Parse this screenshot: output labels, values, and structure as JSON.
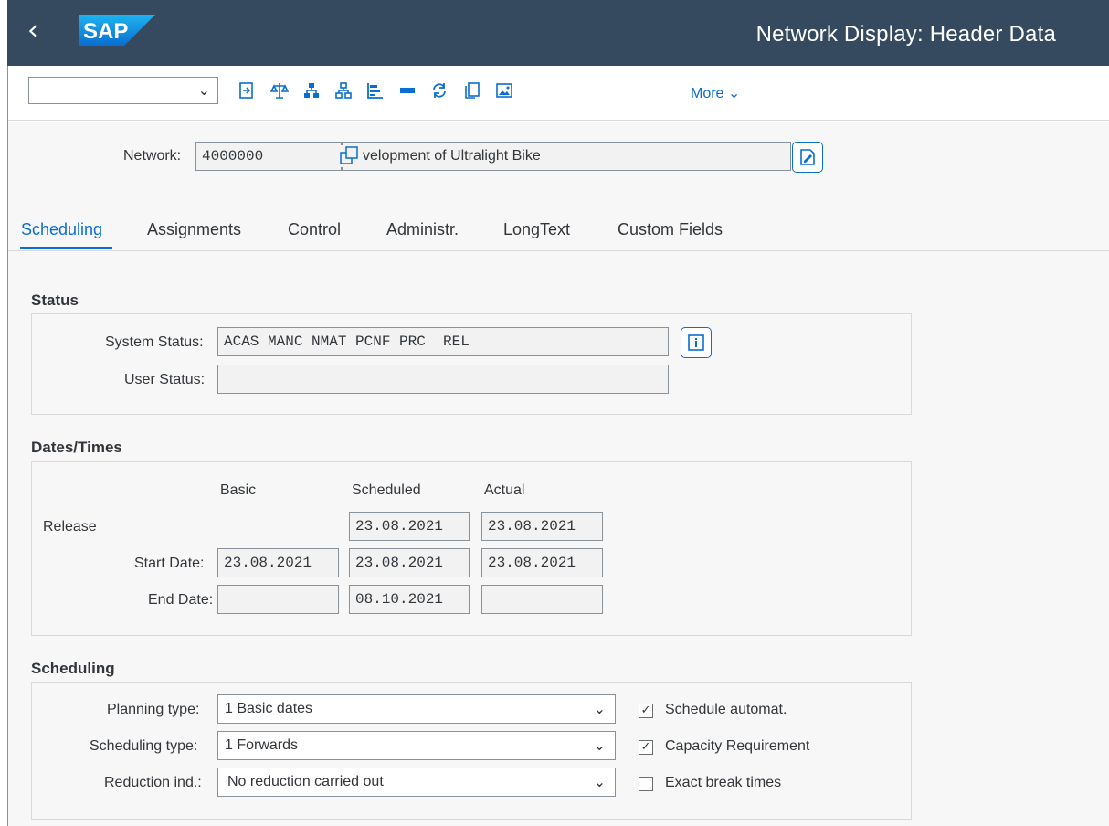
{
  "shell": {
    "title": "Network Display: Header Data",
    "logo_text": "SAP"
  },
  "toolbar": {
    "more_label": "More"
  },
  "header": {
    "network_label": "Network:",
    "network_value": "4000000",
    "network_desc": "velopment of Ultralight Bike"
  },
  "tabs": [
    {
      "label": "Scheduling",
      "active": true
    },
    {
      "label": "Assignments"
    },
    {
      "label": "Control"
    },
    {
      "label": "Administr."
    },
    {
      "label": "LongText"
    },
    {
      "label": "Custom Fields"
    }
  ],
  "status": {
    "title": "Status",
    "system_status_label": "System Status:",
    "system_status_value": "ACAS MANC NMAT PCNF PRC  REL",
    "user_status_label": "User Status:",
    "user_status_value": ""
  },
  "dates": {
    "title": "Dates/Times",
    "col_basic": "Basic",
    "col_scheduled": "Scheduled",
    "col_actual": "Actual",
    "release_label": "Release",
    "release_scheduled": "23.08.2021",
    "release_actual": "23.08.2021",
    "start_label": "Start Date:",
    "start_basic": "23.08.2021",
    "start_scheduled": "23.08.2021",
    "start_actual": "23.08.2021",
    "end_label": "End Date:",
    "end_basic": "",
    "end_scheduled": "08.10.2021",
    "end_actual": ""
  },
  "scheduling": {
    "title": "Scheduling",
    "planning_type_label": "Planning type:",
    "planning_type_value": "1 Basic dates",
    "scheduling_type_label": "Scheduling type:",
    "scheduling_type_value": "1 Forwards",
    "reduction_label": "Reduction ind.:",
    "reduction_value": "No reduction carried out",
    "cb_schedule_automat": {
      "label": "Schedule automat.",
      "checked": true
    },
    "cb_capacity": {
      "label": "Capacity Requirement",
      "checked": true
    },
    "cb_exact_break": {
      "label": "Exact break times",
      "checked": false
    }
  },
  "colors": {
    "shell_bg": "#354a5f",
    "accent": "#0a6ed1"
  }
}
